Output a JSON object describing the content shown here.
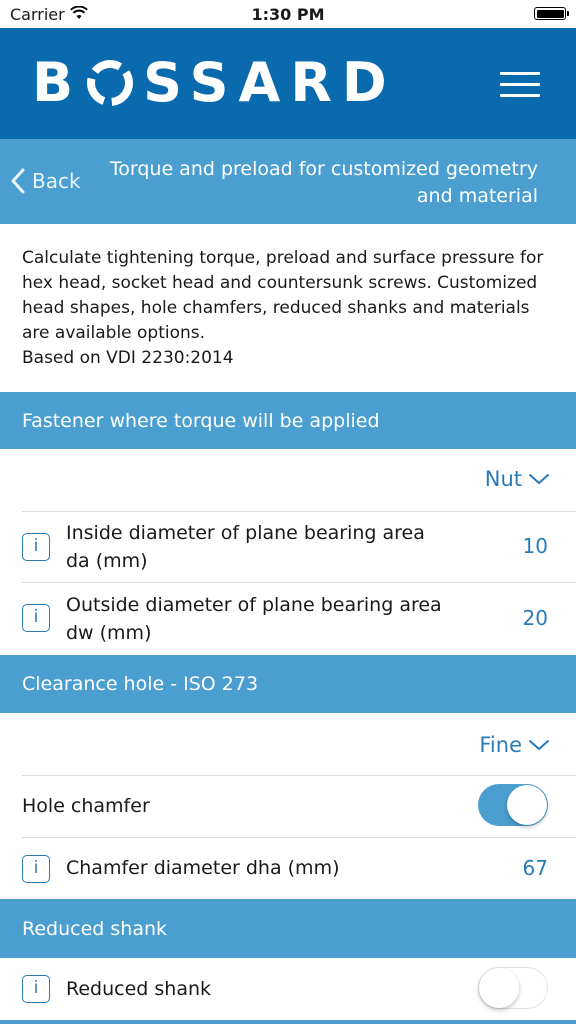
{
  "status_bar": {
    "carrier": "Carrier",
    "time": "1:30 PM"
  },
  "brand": {
    "logo_pre": "B",
    "logo_post": "SSARD"
  },
  "nav": {
    "back_label": "Back",
    "title": "Torque and preload for customized geometry and material"
  },
  "description": {
    "text": "Calculate tightening torque, preload and surface pressure for hex head, socket head and countersunk screws. Customized head shapes, hole chamfers, reduced shanks and materials are available options.",
    "basis": "Based on VDI 2230:2014"
  },
  "sections": {
    "fastener": {
      "title": "Fastener where torque will be applied",
      "picker_value": "Nut",
      "rows": [
        {
          "label": "Inside diameter of plane bearing area da (mm)",
          "value": "10"
        },
        {
          "label": "Outside diameter of plane bearing area dw (mm)",
          "value": "20"
        }
      ]
    },
    "clearance": {
      "title": "Clearance hole - ISO 273",
      "picker_value": "Fine",
      "hole_chamfer_label": "Hole chamfer",
      "hole_chamfer_on": true,
      "chamfer_label": "Chamfer diameter dha (mm)",
      "chamfer_value": "67"
    },
    "reduced_shank": {
      "title": "Reduced shank",
      "toggle_label": "Reduced shank",
      "toggle_on": false
    }
  },
  "info_glyph": "i",
  "colors": {
    "brand_blue": "#0a6aae",
    "section_blue": "#4a9fd0",
    "value_blue": "#2a7ab6"
  }
}
